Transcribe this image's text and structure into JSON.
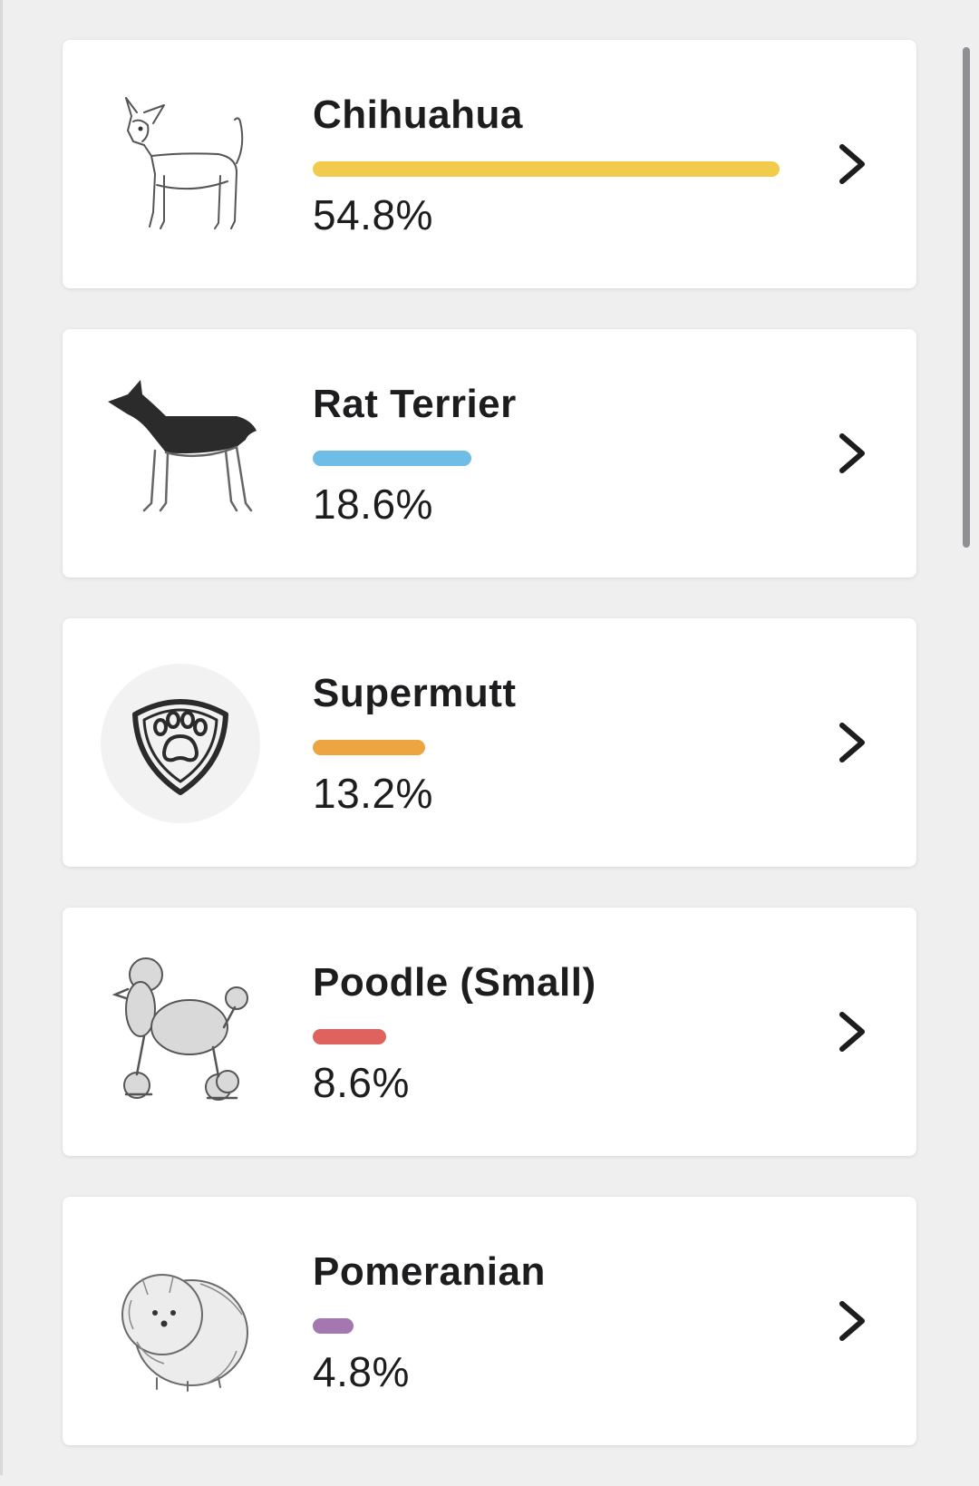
{
  "breeds": [
    {
      "name": "Chihuahua",
      "percent_label": "54.8%",
      "percent": 54.8,
      "bar_color": "#f2cb4d",
      "image": "chihuahua-icon"
    },
    {
      "name": "Rat Terrier",
      "percent_label": "18.6%",
      "percent": 18.6,
      "bar_color": "#6ebde6",
      "image": "rat-terrier-icon"
    },
    {
      "name": "Supermutt",
      "percent_label": "13.2%",
      "percent": 13.2,
      "bar_color": "#eca540",
      "image": "paw-shield-icon"
    },
    {
      "name": "Poodle (Small)",
      "percent_label": "8.6%",
      "percent": 8.6,
      "bar_color": "#e0625e",
      "image": "poodle-icon"
    },
    {
      "name": "Pomeranian",
      "percent_label": "4.8%",
      "percent": 4.8,
      "bar_color": "#a477b1",
      "image": "pomeranian-icon"
    }
  ]
}
